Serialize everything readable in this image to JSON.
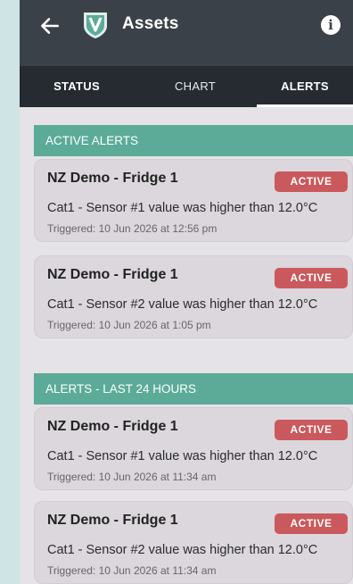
{
  "header": {
    "title": "Assets",
    "back_icon": "arrow-left-icon",
    "logo_icon": "shield-v-logo",
    "info_icon": "info-icon",
    "info_glyph": "i"
  },
  "tabs": [
    {
      "label": "STATUS",
      "selected": false
    },
    {
      "label": "CHART",
      "selected": false
    },
    {
      "label": "ALERTS",
      "selected": true
    }
  ],
  "sections": {
    "active": {
      "title": "ACTIVE ALERTS",
      "alerts": [
        {
          "device": "NZ Demo - Fridge 1",
          "status": "ACTIVE",
          "message": "Cat1 - Sensor #1 value was higher than 12.0°C",
          "triggered": "Triggered: 10 Jun 2026 at 12:56 pm"
        },
        {
          "device": "NZ Demo - Fridge 1",
          "status": "ACTIVE",
          "message": "Cat1 - Sensor #2 value was higher than 12.0°C",
          "triggered": "Triggered: 10 Jun 2026 at 1:05 pm"
        }
      ]
    },
    "recent": {
      "title": "ALERTS - LAST 24 HOURS",
      "alerts": [
        {
          "device": "NZ Demo - Fridge 1",
          "status": "ACTIVE",
          "message": "Cat1 - Sensor #1 value was higher than 12.0°C",
          "triggered": "Triggered: 10 Jun 2026 at 11:34 am"
        },
        {
          "device": "NZ Demo - Fridge 1",
          "status": "ACTIVE",
          "message": "Cat1 - Sensor #2 value was higher than 12.0°C",
          "triggered": "Triggered: 10 Jun 2026 at 11:34 am"
        }
      ]
    }
  },
  "colors": {
    "appbar": "#3b4149",
    "tabbar": "#262b31",
    "section_header": "#5bab98",
    "badge": "#c9595c",
    "card": "#dbd7dc",
    "background": "#e5e3e7",
    "logo_accent": "#5bab98"
  }
}
